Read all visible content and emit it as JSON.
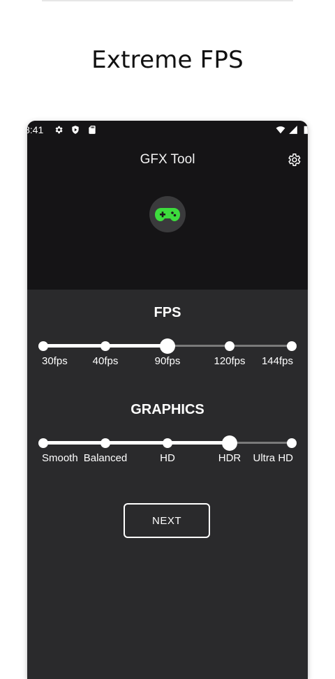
{
  "promo": {
    "title": "Extreme FPS"
  },
  "status_bar": {
    "time": "8:41"
  },
  "app": {
    "title": "GFX Tool",
    "accent_color": "#3ddc3d",
    "icons": {
      "settings": "gear-icon",
      "logo": "gamepad-icon"
    }
  },
  "fps": {
    "title": "FPS",
    "options": [
      "30fps",
      "40fps",
      "90fps",
      "120fps",
      "144fps"
    ],
    "selected_index": 2
  },
  "graphics": {
    "title": "GRAPHICS",
    "options": [
      "Smooth",
      "Balanced",
      "HD",
      "HDR",
      "Ultra HD"
    ],
    "selected_index": 3
  },
  "actions": {
    "next_label": "NEXT"
  }
}
